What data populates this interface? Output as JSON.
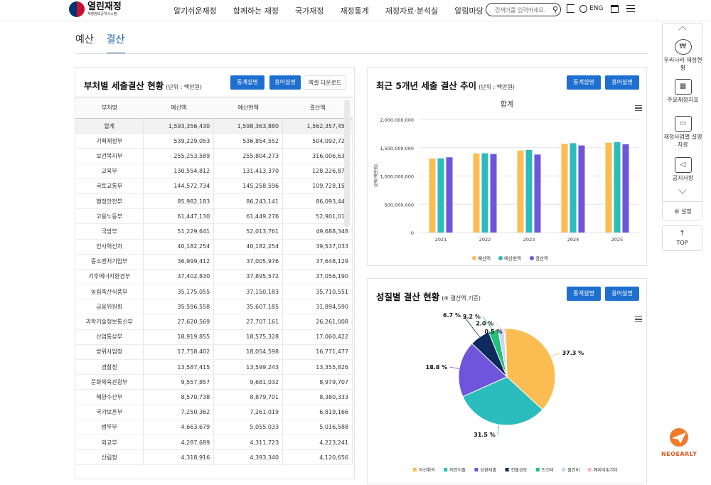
{
  "header": {
    "logo_main": "열린재정",
    "logo_sub": "재정정보공개시스템",
    "nav": [
      "알기쉬운재정",
      "함께하는 재정",
      "국가재정",
      "재정통계",
      "재정자료·분석실",
      "알림마당"
    ],
    "search_placeholder": "검색어를 입력하세요.",
    "lang": "ENG"
  },
  "tabs": [
    "예산",
    "결산"
  ],
  "sidebar": {
    "items": [
      "우리나라 재정현황",
      "주요재정지표",
      "재정사업별 설명자료",
      "공지사항"
    ],
    "settings": "설정",
    "top": "TOP"
  },
  "table_panel": {
    "title": "부처별 세출결산 현황",
    "unit": "(단위 : 백만원)",
    "btn_stats": "통계설명",
    "btn_terms": "용어설명",
    "btn_excel": "엑셀 다운로드",
    "columns": [
      "부처명",
      "예산액",
      "예산현액",
      "결산액"
    ],
    "rows": [
      [
        "합계",
        "1,593,356,430",
        "1,598,363,880",
        "1,562,357,459"
      ],
      [
        "기획재정부",
        "539,229,053",
        "536,854,552",
        "504,092,727"
      ],
      [
        "보건복지부",
        "255,253,589",
        "255,804,273",
        "316,006,632"
      ],
      [
        "교육부",
        "130,554,812",
        "131,413,370",
        "128,226,877"
      ],
      [
        "국토교통부",
        "144,572,734",
        "145,258,596",
        "109,728,154"
      ],
      [
        "행정안전부",
        "85,982,183",
        "86,243,141",
        "86,093,445"
      ],
      [
        "고용노동부",
        "61,447,130",
        "61,449,276",
        "52,901,019"
      ],
      [
        "국방부",
        "51,229,641",
        "52,013,761",
        "49,688,348"
      ],
      [
        "인사혁신처",
        "40,182,254",
        "40,182,254",
        "39,537,033"
      ],
      [
        "중소벤처기업부",
        "36,999,412",
        "37,005,976",
        "37,648,129"
      ],
      [
        "기후에너지환경부",
        "37,402,830",
        "37,895,572",
        "37,056,190"
      ],
      [
        "농림축산식품부",
        "35,175,055",
        "37,150,183",
        "35,710,551"
      ],
      [
        "금융위원회",
        "35,596,558",
        "35,607,185",
        "31,894,590"
      ],
      [
        "과학기술정보통신부",
        "27,620,569",
        "27,707,161",
        "26,261,008"
      ],
      [
        "산업통상부",
        "18,919,855",
        "18,575,328",
        "17,060,422"
      ],
      [
        "방위사업청",
        "17,758,402",
        "18,054,598",
        "16,771,477"
      ],
      [
        "경찰청",
        "13,587,415",
        "13,599,243",
        "13,355,826"
      ],
      [
        "문화체육관광부",
        "9,557,857",
        "9,681,032",
        "8,979,707"
      ],
      [
        "해양수산부",
        "8,570,738",
        "8,879,701",
        "8,380,333"
      ],
      [
        "국가보훈부",
        "7,250,362",
        "7,261,019",
        "6,819,166"
      ],
      [
        "법무부",
        "4,663,679",
        "5,055,033",
        "5,016,588"
      ],
      [
        "외교부",
        "4,287,689",
        "4,311,723",
        "4,223,241"
      ],
      [
        "산림청",
        "4,318,916",
        "4,393,340",
        "4,120,656"
      ]
    ]
  },
  "trend_panel": {
    "title": "최근 5개년 세출 결산 추이",
    "unit": "(단위 : 백만원)",
    "btn_stats": "통계설명",
    "btn_terms": "용어설명"
  },
  "nature_panel": {
    "title": "성질별 결산 현황",
    "unit": "(※ 결산액 기준)",
    "btn_stats": "통계설명",
    "btn_terms": "용어설명"
  },
  "chart_data": [
    {
      "type": "bar",
      "title": "합계",
      "ylabel": "금액(백만원)",
      "categories": [
        "2021",
        "2022",
        "2023",
        "2024",
        "2025"
      ],
      "ylim": [
        0,
        2000000000
      ],
      "yticks": [
        "0",
        "500,000,000",
        "1,000,000,000",
        "1,500,000,000",
        "2,000,000,000"
      ],
      "series": [
        {
          "name": "예산액",
          "color": "#fbbd52",
          "values": [
            1310000000,
            1400000000,
            1450000000,
            1570000000,
            1590000000
          ]
        },
        {
          "name": "예산현액",
          "color": "#2bbcbd",
          "values": [
            1312000000,
            1402000000,
            1460000000,
            1580000000,
            1598000000
          ]
        },
        {
          "name": "결산액",
          "color": "#6e55dc",
          "values": [
            1330000000,
            1390000000,
            1380000000,
            1540000000,
            1562000000
          ]
        }
      ]
    },
    {
      "type": "pie",
      "slices": [
        {
          "name": "자산취득",
          "value": 37.3,
          "label": "37.3 %",
          "color": "#fbbd52"
        },
        {
          "name": "이전지출",
          "value": 31.5,
          "label": "31.5 %",
          "color": "#2bbcbd"
        },
        {
          "name": "상환지출",
          "value": 18.8,
          "label": "18.8 %",
          "color": "#6e55dc"
        },
        {
          "name": "전출금등",
          "value": 6.7,
          "label": "6.7 %",
          "color": "#0f2a5c"
        },
        {
          "name": "인건비",
          "value": 3.2,
          "label": "3.2 %",
          "color": "#22c17a"
        },
        {
          "name": "물건비",
          "value": 2.0,
          "label": "2.0 %",
          "color": "#cdd5f6"
        },
        {
          "name": "예비비및기타",
          "value": 0.5,
          "label": "0.5 %",
          "color": "#f6b6b6"
        }
      ]
    }
  ],
  "watermark": "NEOEARLY"
}
